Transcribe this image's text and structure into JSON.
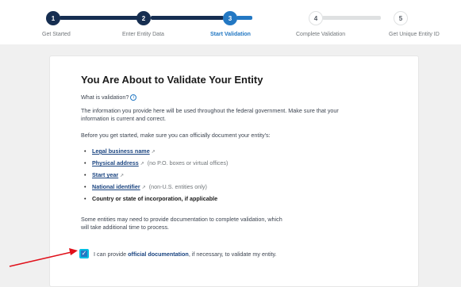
{
  "stepper": {
    "steps": [
      {
        "number": "1",
        "label": "Get Started",
        "state": "done"
      },
      {
        "number": "2",
        "label": "Enter Entity Data",
        "state": "done"
      },
      {
        "number": "3",
        "label": "Start Validation",
        "state": "current"
      },
      {
        "number": "4",
        "label": "Complete Validation",
        "state": "todo"
      },
      {
        "number": "5",
        "label": "Get Unique Entity ID",
        "state": "todo"
      }
    ]
  },
  "card": {
    "title": "You Are About to Validate Your Entity",
    "what_is_validation": "What is validation?",
    "info_icon": "i",
    "intro_line1": "The information you provide here will be used throughout the federal government. Make sure that your",
    "intro_line2": "information is current and correct.",
    "before_start": "Before you get started, make sure you can officially document your entity's:",
    "requirements": [
      {
        "text": "Legal business name",
        "link": true,
        "note": ""
      },
      {
        "text": "Physical address",
        "link": true,
        "note": "(no P.O. boxes or virtual offices)"
      },
      {
        "text": "Start year",
        "link": true,
        "note": ""
      },
      {
        "text": "National identifier",
        "link": true,
        "note": "(non-U.S. entities only)"
      },
      {
        "text": "Country or state of incorporation, if applicable",
        "link": false,
        "note": ""
      }
    ],
    "extra_time_line1": "Some entities may need to provide documentation to complete validation, which",
    "extra_time_line2": "will take additional time to process.",
    "checkbox": {
      "checked": true,
      "prefix": "I can provide ",
      "bold": "official documentation",
      "suffix": ", if necessary, to validate my entity."
    }
  },
  "icons": {
    "external_link": "external-link-icon",
    "checkmark": "checkmark-icon",
    "info": "info-icon"
  },
  "colors": {
    "done": "#162e51",
    "current": "#2378c3",
    "todo": "#dfe1e2",
    "link": "#1a4480",
    "annotation_arrow": "#e0101a"
  }
}
